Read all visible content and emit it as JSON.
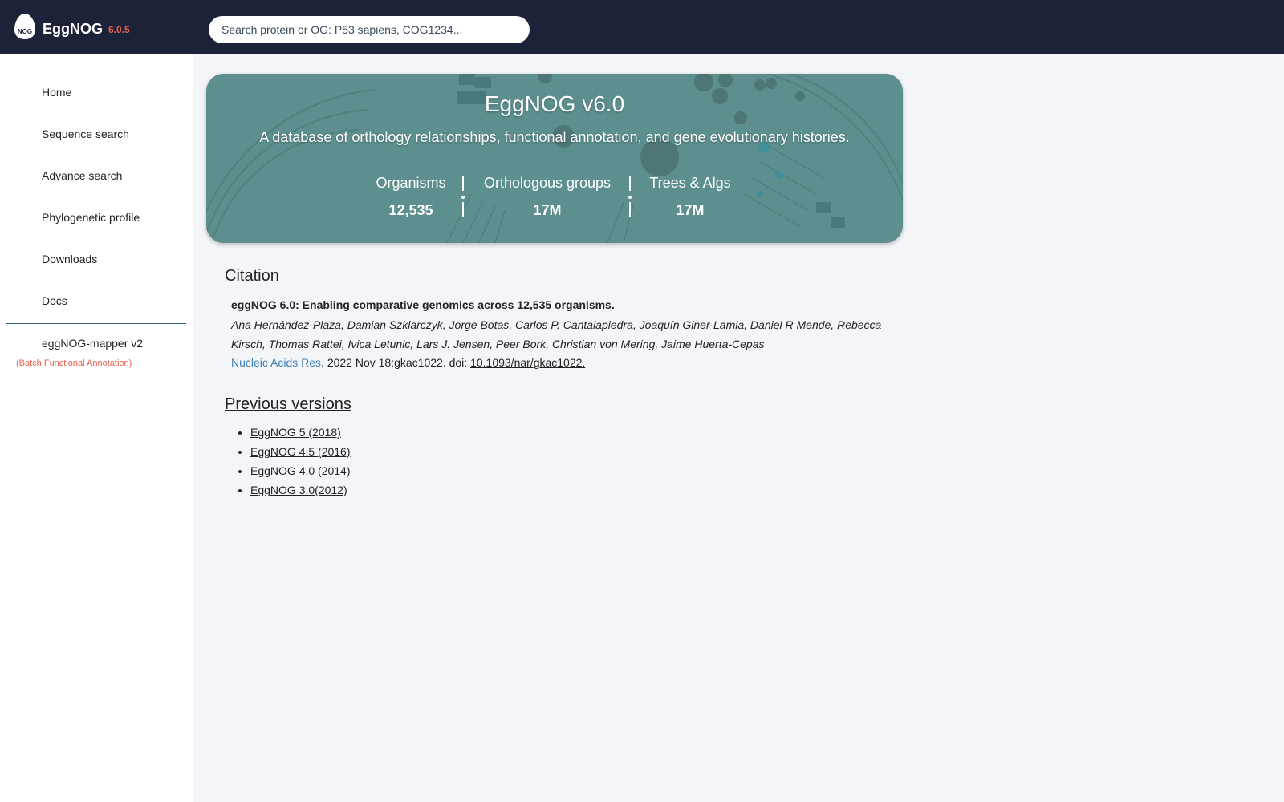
{
  "header": {
    "logo_text": "NOG",
    "brand": "EggNOG",
    "version": "6.0.5",
    "search_placeholder": "Search protein or OG: P53 sapiens, COG1234..."
  },
  "sidebar": {
    "items": [
      {
        "label": "Home"
      },
      {
        "label": "Sequence search"
      },
      {
        "label": "Advance search"
      },
      {
        "label": "Phylogenetic profile"
      },
      {
        "label": "Downloads"
      },
      {
        "label": "Docs"
      }
    ],
    "mapper": {
      "label": "eggNOG-mapper v2",
      "sublabel": "(Batch Functional Annotation)"
    }
  },
  "banner": {
    "title": "EggNOG v6.0",
    "subtitle": "A database of orthology relationships, functional annotation, and gene evolutionary histories.",
    "stats": [
      {
        "label": "Organisms",
        "value": "12,535"
      },
      {
        "label": "Orthologous groups",
        "value": "17M"
      },
      {
        "label": "Trees & Algs",
        "value": "17M"
      }
    ]
  },
  "citation": {
    "heading": "Citation",
    "title": "eggNOG 6.0: Enabling comparative genomics across 12,535 organisms.",
    "authors": "Ana Hernández-Plaza, Damian Szklarczyk, Jorge Botas, Carlos P. Cantalapiedra, Joaquín Giner-Lamia, Daniel R Mende, Rebecca Kirsch, Thomas Rattei, Ivica Letunic, Lars J. Jensen, Peer Bork, Christian von Mering, Jaime Huerta-Cepas",
    "journal": "Nucleic Acids Res",
    "ref_text": ". 2022 Nov 18:gkac1022. doi: ",
    "doi": "10.1093/nar/gkac1022."
  },
  "previous": {
    "heading": "Previous versions",
    "items": [
      {
        "label": "EggNOG 5 (2018)"
      },
      {
        "label": "EggNOG 4.5 (2016)"
      },
      {
        "label": "EggNOG 4.0 (2014)"
      },
      {
        "label": "EggNOG 3.0(2012)"
      }
    ]
  },
  "colors": {
    "topbar": "#1c2338",
    "accent": "#e8604c",
    "banner": "#5c8f8d",
    "link": "#3f7fae"
  }
}
